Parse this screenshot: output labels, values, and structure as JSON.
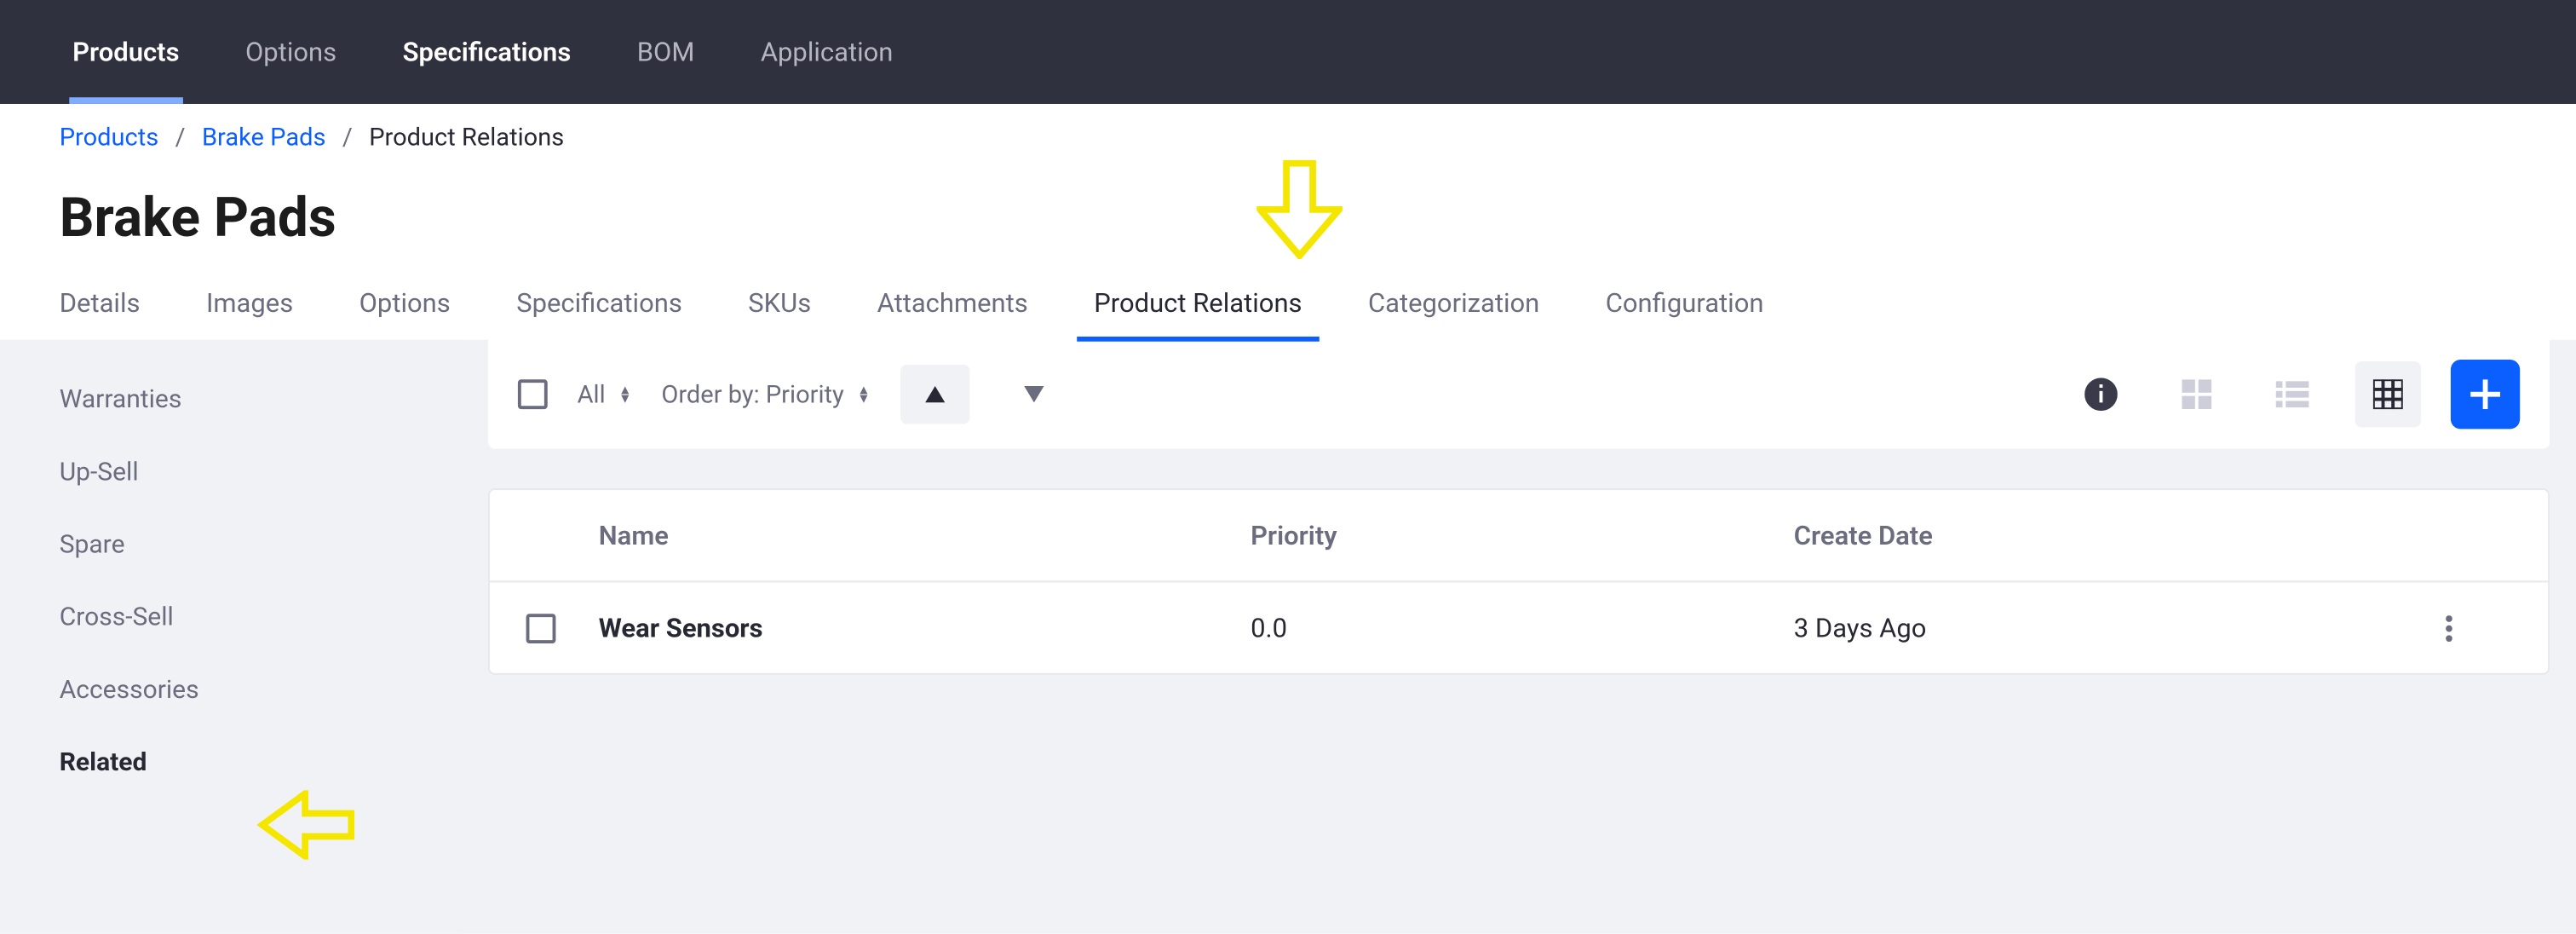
{
  "topnav": {
    "items": [
      {
        "label": "Products",
        "active": true
      },
      {
        "label": "Options"
      },
      {
        "label": "Specifications",
        "bold": true
      },
      {
        "label": "BOM"
      },
      {
        "label": "Application"
      }
    ]
  },
  "breadcrumb": {
    "items": [
      "Products",
      "Brake Pads"
    ],
    "current": "Product Relations"
  },
  "page_title": "Brake Pads",
  "subtabs": [
    {
      "label": "Details"
    },
    {
      "label": "Images"
    },
    {
      "label": "Options"
    },
    {
      "label": "Specifications"
    },
    {
      "label": "SKUs"
    },
    {
      "label": "Attachments"
    },
    {
      "label": "Product Relations",
      "active": true
    },
    {
      "label": "Categorization"
    },
    {
      "label": "Configuration"
    }
  ],
  "sidebar": {
    "items": [
      {
        "label": "Warranties"
      },
      {
        "label": "Up-Sell"
      },
      {
        "label": "Spare"
      },
      {
        "label": "Cross-Sell"
      },
      {
        "label": "Accessories"
      },
      {
        "label": "Related",
        "active": true
      }
    ]
  },
  "toolbar": {
    "filter_label": "All",
    "order_by_label": "Order by: Priority"
  },
  "table": {
    "headers": {
      "name": "Name",
      "priority": "Priority",
      "create_date": "Create Date"
    },
    "rows": [
      {
        "name": "Wear Sensors",
        "priority": "0.0",
        "create_date": "3 Days Ago"
      }
    ]
  },
  "colors": {
    "accent": "#0b5fff",
    "topnav_bg": "#30313f",
    "annotation": "#f5e600"
  },
  "annotations": [
    {
      "type": "arrow-down",
      "target": "subtab-product-relations"
    },
    {
      "type": "arrow-left",
      "target": "sidebar-item-related"
    }
  ]
}
